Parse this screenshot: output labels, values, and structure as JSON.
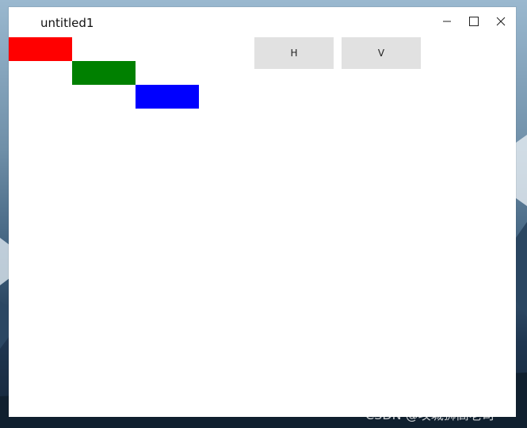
{
  "window": {
    "title": "untitled1"
  },
  "titlebar_controls": {
    "minimize_icon": "minimize-icon",
    "maximize_icon": "maximize-icon",
    "close_icon": "close-icon"
  },
  "rects": [
    {
      "color": "#ff0000"
    },
    {
      "color": "#008000"
    },
    {
      "color": "#0000ff"
    }
  ],
  "buttons": {
    "h_label": "H",
    "v_label": "V"
  },
  "watermark": "CSDN @攻城狮高老司"
}
